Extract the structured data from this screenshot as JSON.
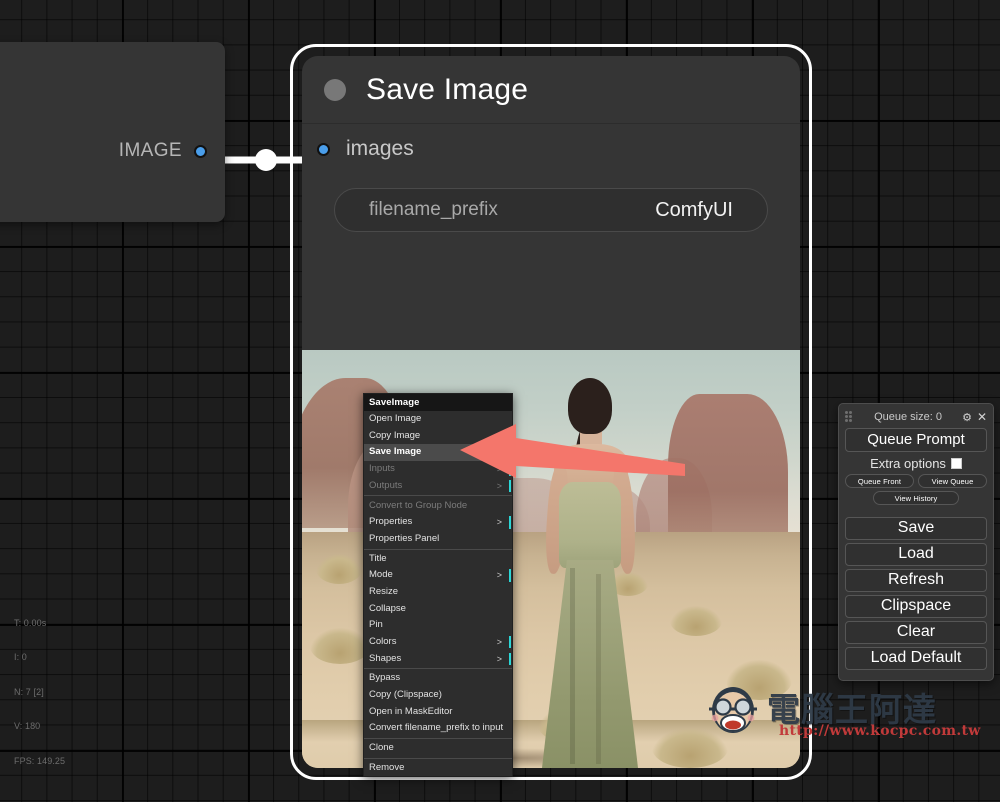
{
  "app": {
    "name": "ComfyUI",
    "background_color": "#1d1d1d"
  },
  "stats": {
    "time": "T: 0.00s",
    "iterations": "I: 0",
    "nodes": "N: 7 [2]",
    "vertices": "V: 180",
    "fps": "FPS: 149.25"
  },
  "source_node": {
    "output_label": "IMAGE",
    "port_color": "#4a9eea"
  },
  "save_node": {
    "title": "Save Image",
    "input_label": "images",
    "widget": {
      "name": "filename_prefix",
      "value": "ComfyUI"
    },
    "selected": true,
    "border_color": "#ffffff"
  },
  "context_menu": {
    "title": "SaveImage",
    "highlight_color": "#4b4b4b",
    "submenu_marker_color": "#2bd6d6",
    "items": [
      {
        "label": "Open Image",
        "disabled": false,
        "submenu": false,
        "selected": false,
        "sep_after": false
      },
      {
        "label": "Copy Image",
        "disabled": false,
        "submenu": false,
        "selected": false,
        "sep_after": false
      },
      {
        "label": "Save Image",
        "disabled": false,
        "submenu": false,
        "selected": true,
        "sep_after": false
      },
      {
        "label": "Inputs",
        "disabled": true,
        "submenu": true,
        "selected": false,
        "sep_after": false
      },
      {
        "label": "Outputs",
        "disabled": true,
        "submenu": true,
        "selected": false,
        "sep_after": true
      },
      {
        "label": "Convert to Group Node",
        "disabled": true,
        "submenu": false,
        "selected": false,
        "sep_after": false
      },
      {
        "label": "Properties",
        "disabled": false,
        "submenu": true,
        "selected": false,
        "sep_after": false
      },
      {
        "label": "Properties Panel",
        "disabled": false,
        "submenu": false,
        "selected": false,
        "sep_after": true
      },
      {
        "label": "Title",
        "disabled": false,
        "submenu": false,
        "selected": false,
        "sep_after": false
      },
      {
        "label": "Mode",
        "disabled": false,
        "submenu": true,
        "selected": false,
        "sep_after": false
      },
      {
        "label": "Resize",
        "disabled": false,
        "submenu": false,
        "selected": false,
        "sep_after": false
      },
      {
        "label": "Collapse",
        "disabled": false,
        "submenu": false,
        "selected": false,
        "sep_after": false
      },
      {
        "label": "Pin",
        "disabled": false,
        "submenu": false,
        "selected": false,
        "sep_after": false
      },
      {
        "label": "Colors",
        "disabled": false,
        "submenu": true,
        "selected": false,
        "sep_after": false
      },
      {
        "label": "Shapes",
        "disabled": false,
        "submenu": true,
        "selected": false,
        "sep_after": true
      },
      {
        "label": "Bypass",
        "disabled": false,
        "submenu": false,
        "selected": false,
        "sep_after": false
      },
      {
        "label": "Copy (Clipspace)",
        "disabled": false,
        "submenu": false,
        "selected": false,
        "sep_after": false
      },
      {
        "label": "Open in MaskEditor",
        "disabled": false,
        "submenu": false,
        "selected": false,
        "sep_after": false
      },
      {
        "label": "Convert filename_prefix to input",
        "disabled": false,
        "submenu": false,
        "selected": false,
        "sep_after": true
      },
      {
        "label": "Clone",
        "disabled": false,
        "submenu": false,
        "selected": false,
        "sep_after": true
      },
      {
        "label": "Remove",
        "disabled": false,
        "submenu": false,
        "selected": false,
        "sep_after": false
      }
    ],
    "submenu_arrow": ">"
  },
  "annotation": {
    "arrow_color": "#f4766b",
    "points_to": "Save Image"
  },
  "queue_panel": {
    "queue_size_label": "Queue size: 0",
    "gear_icon": "gear-icon",
    "close_icon": "close-icon",
    "queue_prompt_label": "Queue Prompt",
    "extra_options_label": "Extra options",
    "extra_options_checked": false,
    "small_buttons": [
      "Queue Front",
      "View Queue"
    ],
    "history_button": "View History",
    "action_buttons": [
      "Save",
      "Load",
      "Refresh",
      "Clipspace",
      "Clear",
      "Load Default"
    ]
  },
  "watermark": {
    "text": "電腦王阿達",
    "url": "http://www.kocpc.com.tw"
  }
}
